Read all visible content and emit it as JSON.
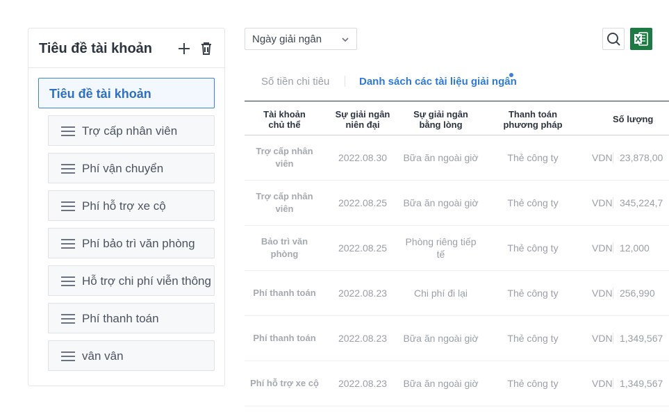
{
  "sidebar": {
    "title": "Tiêu đề tài khoản",
    "selected": "Tiêu đề tài khoản",
    "items": [
      {
        "label": "Trợ cấp nhân viên"
      },
      {
        "label": "Phí vận chuyển"
      },
      {
        "label": "Phí hỗ trợ xe cộ"
      },
      {
        "label": "Phí bảo trì văn phòng"
      },
      {
        "label": "Hỗ trợ chi phí viễn thông"
      },
      {
        "label": "Phí thanh toán"
      },
      {
        "label": "vân vân"
      }
    ]
  },
  "toolbar": {
    "date_select_value": "Ngày giải ngân"
  },
  "tabs": [
    {
      "label": "Số tiền chi tiêu",
      "active": false
    },
    {
      "label": "Danh sách các tài liệu giải ngân",
      "active": true
    }
  ],
  "table": {
    "headers": [
      {
        "line1": "Tài khoản",
        "line2": "chủ thể"
      },
      {
        "line1": "Sự giải ngân",
        "line2": "niên đại"
      },
      {
        "line1": "Sự giải ngân",
        "line2": "bằng lòng"
      },
      {
        "line1": "Thanh toán",
        "line2": "phương pháp"
      },
      {
        "line1": "",
        "line2": ""
      },
      {
        "line1": "Số lượng",
        "line2": ""
      }
    ],
    "rows": [
      {
        "account": "Trợ cấp nhân viên",
        "date": "2022.08.30",
        "content": "Bữa ăn ngoài giờ",
        "method": "Thẻ công ty",
        "currency": "VDN",
        "amount": "23,878,00"
      },
      {
        "account": "Trợ cấp nhân viên",
        "date": "2022.08.25",
        "content": "Bữa ăn ngoài giờ",
        "method": "Thẻ công ty",
        "currency": "VDN",
        "amount": "345,224,7"
      },
      {
        "account": "Bảo trì văn phòng",
        "date": "2022.08.25",
        "content": "Phòng riêng tiếp tế",
        "method": "Thẻ công ty",
        "currency": "VDN",
        "amount": "12,000"
      },
      {
        "account": "Phí thanh toán",
        "date": "2022.08.23",
        "content": "Chi phí đi lại",
        "method": "Thẻ công ty",
        "currency": "VDN",
        "amount": "256,990"
      },
      {
        "account": "Phí thanh toán",
        "date": "2022.08.23",
        "content": "Bữa ăn ngoài giờ",
        "method": "Thẻ công ty",
        "currency": "VDN",
        "amount": "1,349,567"
      },
      {
        "account": "Phí hỗ trợ xe cộ",
        "date": "2022.08.23",
        "content": "Bữa ăn ngoài giờ",
        "method": "Thẻ công ty",
        "currency": "VDN",
        "amount": "1,349,567"
      }
    ]
  },
  "colors": {
    "accent": "#3b82d6",
    "excel": "#1d7a45"
  },
  "icons": [
    "plus-icon",
    "trash-icon",
    "drag-handle-icon",
    "chevron-down-icon",
    "search-icon",
    "excel-icon"
  ]
}
